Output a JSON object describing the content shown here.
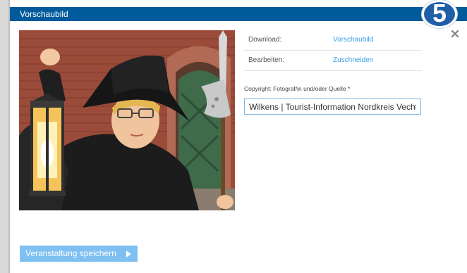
{
  "dialog": {
    "title": "Vorschaubild",
    "step_number": "5",
    "close_icon": "close-icon"
  },
  "image_actions": [
    {
      "label": "Download:",
      "link": "Vorschaubild"
    },
    {
      "label": "Bearbeiten:",
      "link": "Zuschneiden"
    }
  ],
  "copyright": {
    "label": "Copyright: Fotograf/in und/oder Quelle *",
    "value": "Wilkens | Tourist-Information Nordkreis Vechta"
  },
  "save_button": {
    "label": "Veranstaltung speichern",
    "icon": "chevron-right-icon"
  },
  "colors": {
    "header": "#005a9c",
    "link": "#3aa0e6",
    "button": "#7ec0f2",
    "badge": "#1e5fa8"
  }
}
